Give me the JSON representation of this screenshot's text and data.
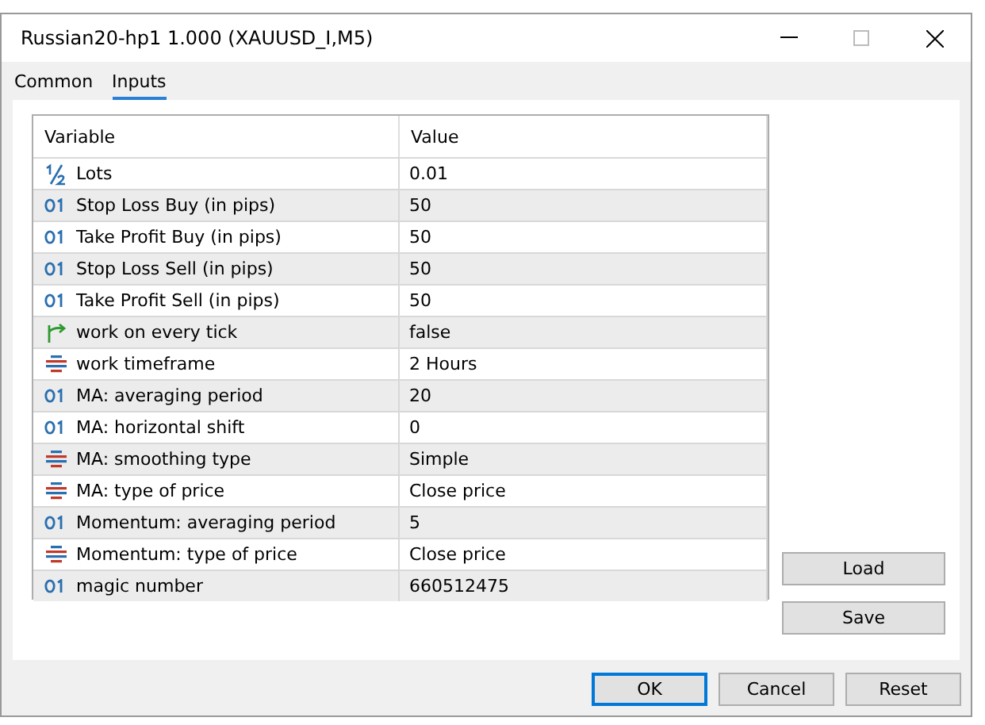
{
  "window": {
    "title": "Russian20-hp1 1.000 (XAUUSD_I,M5)"
  },
  "tabs": [
    {
      "label": "Common",
      "selected": false
    },
    {
      "label": "Inputs",
      "selected": true
    }
  ],
  "table": {
    "columns": [
      "Variable",
      "Value"
    ],
    "rows": [
      {
        "kind": "double",
        "variable": "Lots",
        "value": "0.01"
      },
      {
        "kind": "integer",
        "variable": "Stop Loss Buy (in pips)",
        "value": "50"
      },
      {
        "kind": "integer",
        "variable": "Take Profit Buy (in pips)",
        "value": "50"
      },
      {
        "kind": "integer",
        "variable": "Stop Loss Sell (in pips)",
        "value": "50"
      },
      {
        "kind": "integer",
        "variable": "Take Profit Sell (in pips)",
        "value": "50"
      },
      {
        "kind": "bool",
        "variable": "work on every tick",
        "value": "false"
      },
      {
        "kind": "enum",
        "variable": "work timeframe",
        "value": "2 Hours"
      },
      {
        "kind": "integer",
        "variable": "MA: averaging period",
        "value": "20"
      },
      {
        "kind": "integer",
        "variable": "MA: horizontal shift",
        "value": "0"
      },
      {
        "kind": "enum",
        "variable": "MA: smoothing type",
        "value": "Simple"
      },
      {
        "kind": "enum",
        "variable": "MA: type of price",
        "value": "Close price"
      },
      {
        "kind": "integer",
        "variable": "Momentum: averaging period",
        "value": "5"
      },
      {
        "kind": "enum",
        "variable": "Momentum: type of price",
        "value": "Close price"
      },
      {
        "kind": "integer",
        "variable": "magic number",
        "value": "660512475"
      }
    ]
  },
  "side_buttons": [
    "Load",
    "Save"
  ],
  "footer_buttons": [
    {
      "label": "OK",
      "default": true
    },
    {
      "label": "Cancel",
      "default": false
    },
    {
      "label": "Reset",
      "default": false
    }
  ]
}
